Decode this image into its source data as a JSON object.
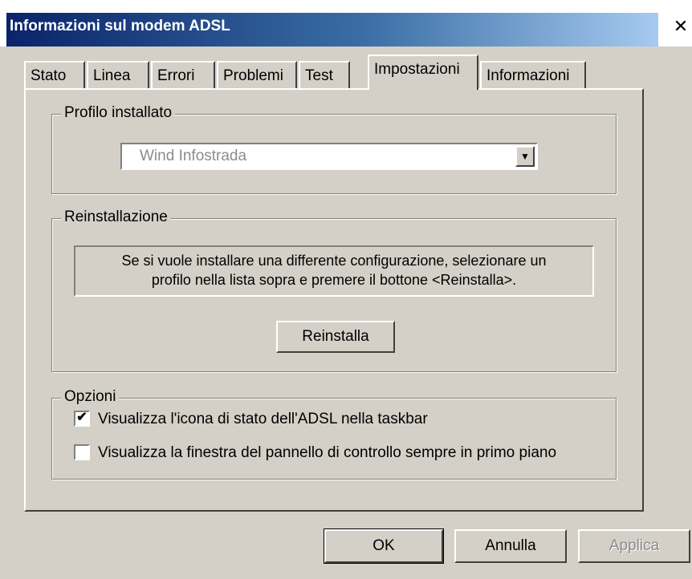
{
  "window": {
    "title": "Informazioni sul modem ADSL",
    "close_glyph": "✕"
  },
  "tabs": [
    {
      "label": "Stato"
    },
    {
      "label": "Linea"
    },
    {
      "label": "Errori"
    },
    {
      "label": "Problemi"
    },
    {
      "label": "Test"
    },
    {
      "label": "Impostazioni",
      "active": true
    },
    {
      "label": "Informazioni"
    }
  ],
  "profile_group": {
    "legend": "Profilo installato",
    "selected_profile": "Wind Infostrada",
    "arrow_glyph": "▼"
  },
  "reinstall_group": {
    "legend": "Reinstallazione",
    "info_line1": "Se si vuole installare una differente configurazione, selezionare un",
    "info_line2": "profilo nella lista sopra e premere il bottone <Reinstalla>.",
    "button_label": "Reinstalla"
  },
  "options_group": {
    "legend": "Opzioni",
    "options": [
      {
        "label": "Visualizza l'icona di stato dell'ADSL nella taskbar",
        "checked": true
      },
      {
        "label": "Visualizza la finestra del pannello di controllo sempre in primo piano",
        "checked": false
      }
    ],
    "check_glyph": "✔"
  },
  "buttons": {
    "ok": "OK",
    "cancel": "Annulla",
    "apply": "Applica"
  },
  "colors": {
    "face": "#d4d0c8",
    "title_start": "#0a246a",
    "title_end": "#a6caf0"
  }
}
